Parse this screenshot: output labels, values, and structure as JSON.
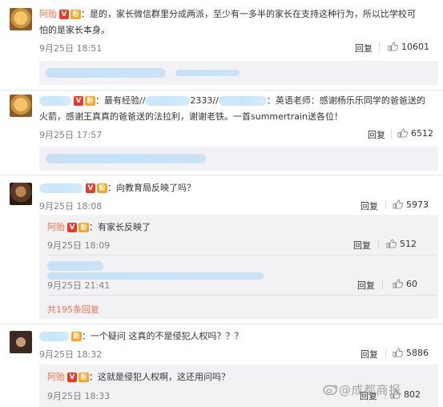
{
  "comments": [
    {
      "username": "阿贻",
      "text": "：是的，家长微信群里分成两派，至少有一多半的家长在支持这种行为，所以比学校可",
      "text2": "怕的是家长本身。",
      "time": "9月25日 18:51",
      "reply_label": "回复",
      "likes": "10601"
    },
    {
      "text_a": "：最有经验//",
      "text_b": "2333//",
      "text_c": "：英语老师：感谢杨乐乐同学的爸爸送的",
      "text2": "火箭，感谢王真真的爸爸送的法拉利，谢谢老铁。一首summertrain送各位！",
      "time": "9月25日 17:57",
      "reply_label": "回复",
      "likes": "6512"
    },
    {
      "text": "：向教育局反映了吗？",
      "time": "9月25日 18:08",
      "reply_label": "回复",
      "likes": "5973",
      "replies": [
        {
          "username": "阿贻",
          "text": "：有家长反映了",
          "time": "9月25日 18:09",
          "reply_label": "回复",
          "likes": "512"
        },
        {
          "time": "9月25日 21:41",
          "reply_label": "回复",
          "likes": "60"
        }
      ],
      "more_replies": "共195条回复"
    },
    {
      "text": "：一个疑问 这真的不是侵犯人权吗？？？",
      "time": "9月25日 18:32",
      "reply_label": "回复",
      "likes": "5886",
      "replies": [
        {
          "username": "阿贻",
          "text": "：这就是侵犯人权啊，这还用问吗？",
          "time": "9月25日 18:33",
          "reply_label": "回复",
          "likes": "802"
        }
      ]
    }
  ],
  "badges": {
    "verified": "V",
    "fan": "粉"
  },
  "watermark": "@成都商报",
  "colors": {
    "username": "#eb7350",
    "time": "#808080",
    "subbox_bg": "#f2f2f5"
  },
  "icons": {
    "like": "thumbs-up-icon",
    "watermark": "weibo-logo-icon"
  }
}
